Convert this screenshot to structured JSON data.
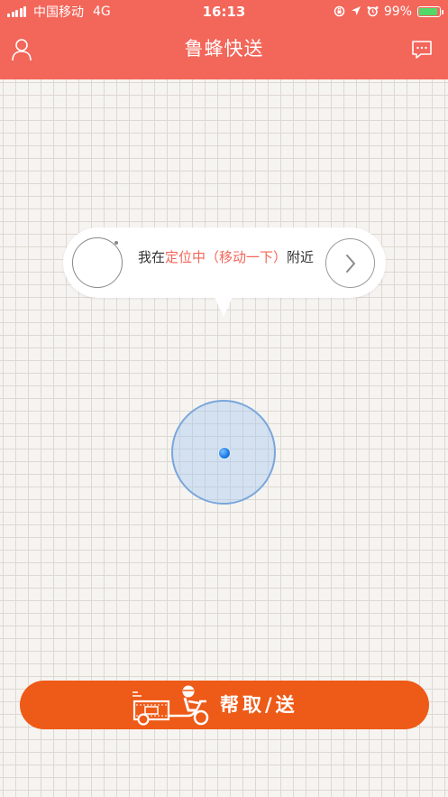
{
  "status_bar": {
    "carrier": "中国移动",
    "network": "4G",
    "time": "16:13",
    "battery_percent": "99%",
    "battery_level": 0.99
  },
  "header": {
    "title": "鲁蜂快送",
    "left_icon": "user-icon",
    "right_icon": "message-icon"
  },
  "location_bubble": {
    "prefix": "我在",
    "highlight": "定位中（移动一下）",
    "suffix": "附近"
  },
  "action": {
    "label": "帮取/送"
  },
  "colors": {
    "header": "#f3665a",
    "highlight": "#f3665a",
    "action": "#ee5a17",
    "location": "#1a78e6"
  }
}
